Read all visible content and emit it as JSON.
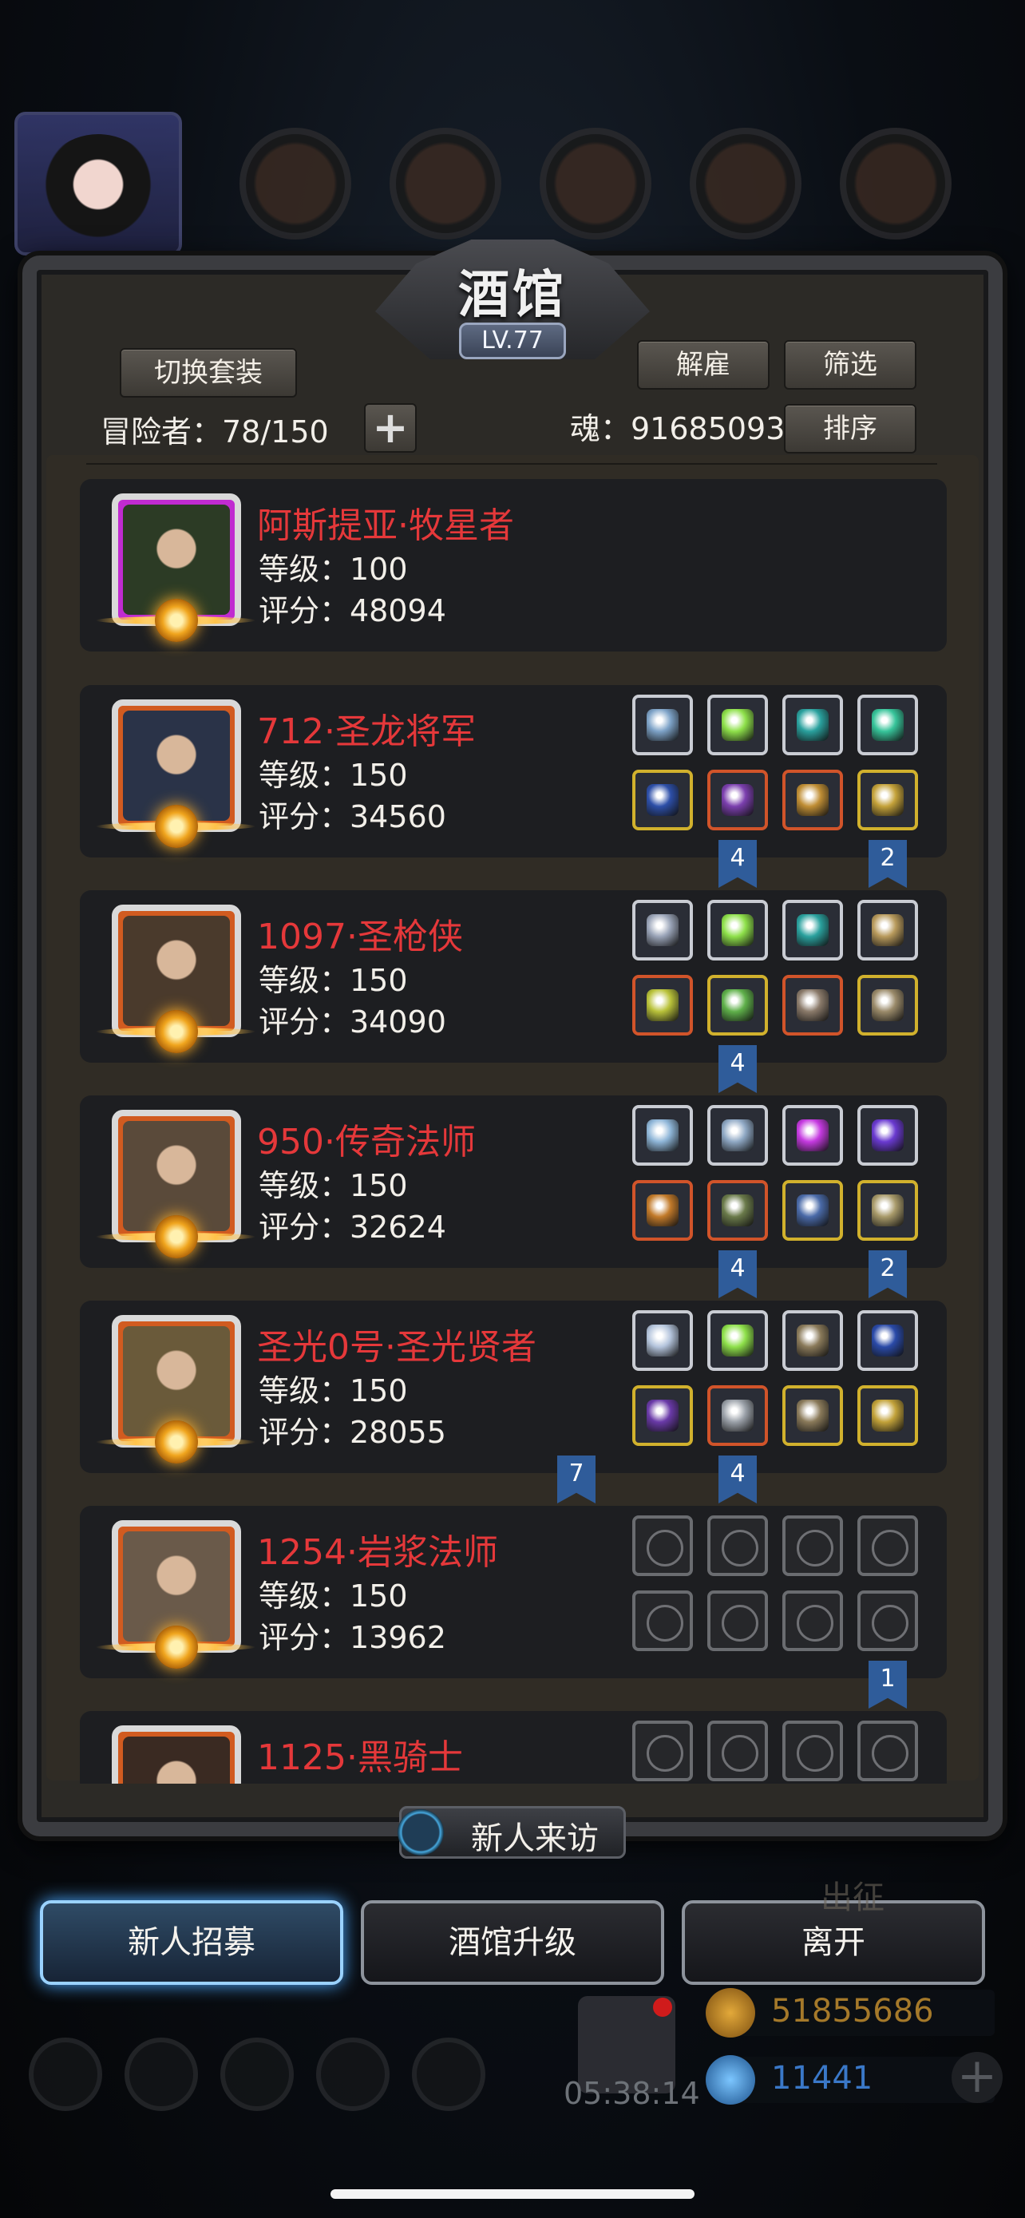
{
  "tavern": {
    "title": "酒馆",
    "level": "LV.77",
    "switch_outfit": "切换套装",
    "dismiss": "解雇",
    "filter": "筛选",
    "sort": "排序",
    "adventurers_label": "冒险者：78/150",
    "soul_label": "魂：91685093",
    "plus": "+"
  },
  "heroes": [
    {
      "name": "阿斯提亚·牧星者",
      "level": "等级：100",
      "score": "评分：48094",
      "frame": "#c02bd0",
      "face": "#2c3b25",
      "slots": [],
      "ribbons": []
    },
    {
      "name": "712·圣龙将军",
      "level": "等级：150",
      "score": "评分：34560",
      "frame": "#d15b20",
      "face": "#2a3348",
      "slots": [
        "#7ea3c8",
        "#8ee04a",
        "#2aa19e",
        "#37c49a",
        "#2d4fa8",
        "#7b3fae",
        "#c08e35",
        "#c4a23a"
      ],
      "slot_frames": [
        "#c9ccd3",
        "#c9ccd3",
        "#c9ccd3",
        "#c9ccd3",
        "#d1b12d",
        "#d1542a",
        "#d1542a",
        "#d1b12d"
      ],
      "ribbons": [
        {
          "text": "4",
          "col": 1
        },
        {
          "text": "2",
          "col": 3
        }
      ]
    },
    {
      "name": "1097·圣枪侠",
      "level": "等级：150",
      "score": "评分：34090",
      "frame": "#d15b20",
      "face": "#4a3a2c",
      "slots": [
        "#9aa4b8",
        "#8ee04a",
        "#2aa19e",
        "#b89a5c",
        "#b9c23a",
        "#5fb04a",
        "#8a7a6a",
        "#9a8a6a"
      ],
      "slot_frames": [
        "#c9ccd3",
        "#c9ccd3",
        "#c9ccd3",
        "#c9ccd3",
        "#d1542a",
        "#d1b12d",
        "#d1542a",
        "#d1b12d"
      ],
      "ribbons": [
        {
          "text": "4",
          "col": 1
        }
      ]
    },
    {
      "name": "950·传奇法师",
      "level": "等级：150",
      "score": "评分：32624",
      "frame": "#d15b20",
      "face": "#5a4a3a",
      "slots": [
        "#8fb6d8",
        "#8fa8c4",
        "#c53ae0",
        "#6a3ad0",
        "#c27a2a",
        "#6a7a4a",
        "#4a6aa8",
        "#a89a6a"
      ],
      "slot_frames": [
        "#c9ccd3",
        "#c9ccd3",
        "#c9ccd3",
        "#c9ccd3",
        "#d1542a",
        "#d1542a",
        "#d1b12d",
        "#d1b12d"
      ],
      "ribbons": [
        {
          "text": "4",
          "col": 1
        },
        {
          "text": "2",
          "col": 3
        }
      ]
    },
    {
      "name": "圣光0号·圣光贤者",
      "level": "等级：150",
      "score": "评分：28055",
      "frame": "#d15b20",
      "face": "#6a5a3a",
      "slots": [
        "#b4c4dc",
        "#8ee04a",
        "#8a7a5a",
        "#2a4aa8",
        "#6a3aa8",
        "#9aa0a8",
        "#8a7a5a",
        "#c2a23a"
      ],
      "slot_frames": [
        "#c9ccd3",
        "#c9ccd3",
        "#c9ccd3",
        "#c9ccd3",
        "#d1b12d",
        "#d1542a",
        "#d1b12d",
        "#d1b12d"
      ],
      "ribbons": [
        {
          "text": "7",
          "col": -1
        },
        {
          "text": "4",
          "col": 1
        }
      ]
    },
    {
      "name": "1254·岩浆法师",
      "level": "等级：150",
      "score": "评分：13962",
      "frame": "#d15b20",
      "face": "#6a5a4a",
      "slots": [
        "",
        "",
        "",
        "",
        "",
        "",
        "",
        ""
      ],
      "empty": true,
      "ribbons": [
        {
          "text": "1",
          "col": 3
        }
      ]
    },
    {
      "name": "1125·黑骑士",
      "level": "",
      "score": "",
      "frame": "#d15b20",
      "face": "#3a2a22",
      "slots": [
        "",
        "",
        "",
        ""
      ],
      "empty": true,
      "ribbons": []
    }
  ],
  "visitor": {
    "label": "新人来访"
  },
  "actions": {
    "recruit": "新人招募",
    "upgrade": "酒馆升级",
    "leave": "离开"
  },
  "background": {
    "gold": "51855686",
    "gems": "11441",
    "timer": "05:38:14",
    "depart": "出征"
  }
}
